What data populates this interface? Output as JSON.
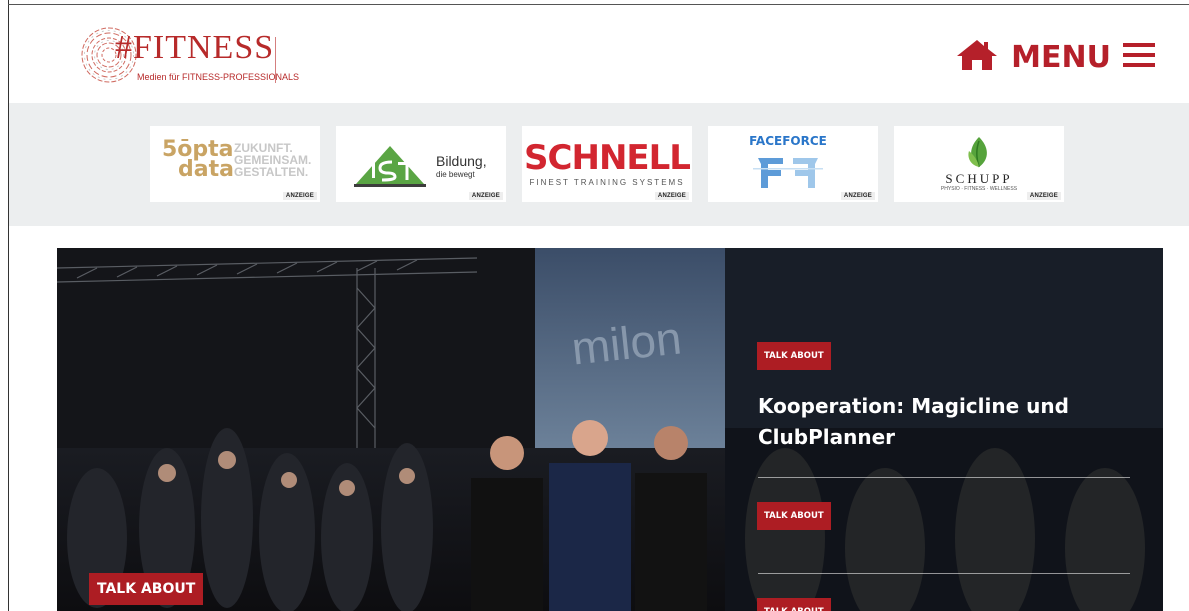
{
  "header": {
    "logo_text": "#FITNESS",
    "logo_tagline": "Medien für FITNESS-PROFESSIONALS",
    "menu_label": "MENU"
  },
  "sponsors": [
    {
      "name": "50 opta data",
      "line1": "5ōpta",
      "line2": "data",
      "slogan": "ZUKUNFT.\nGEMEINSAM.\nGESTALTEN.",
      "badge": "ANZEIGE"
    },
    {
      "name": "IST",
      "text": "Bildung,",
      "subtext": "die bewegt",
      "badge": "ANZEIGE"
    },
    {
      "name": "SCHNELL",
      "brand": "SCHNELL",
      "slogan": "FINEST TRAINING SYSTEMS",
      "badge": "ANZEIGE"
    },
    {
      "name": "FACEFORCE",
      "brand": "FACEFORCE",
      "badge": "ANZEIGE"
    },
    {
      "name": "SCHUPP",
      "brand": "SCHUPP",
      "slogan": "PHYSIO · FITNESS · WELLNESS",
      "badge": "ANZEIGE"
    }
  ],
  "hero": {
    "photo_category": "TALK ABOUT",
    "photo_screen_text": "milon",
    "articles": [
      {
        "category": "TALK ABOUT",
        "title": "Kooperation: Magicline und ClubPlanner"
      },
      {
        "category": "TALK ABOUT"
      },
      {
        "category": "TALK ABOUT"
      }
    ]
  },
  "colors": {
    "brand_red": "#ad1d23",
    "strip_bg": "#eceeef"
  }
}
